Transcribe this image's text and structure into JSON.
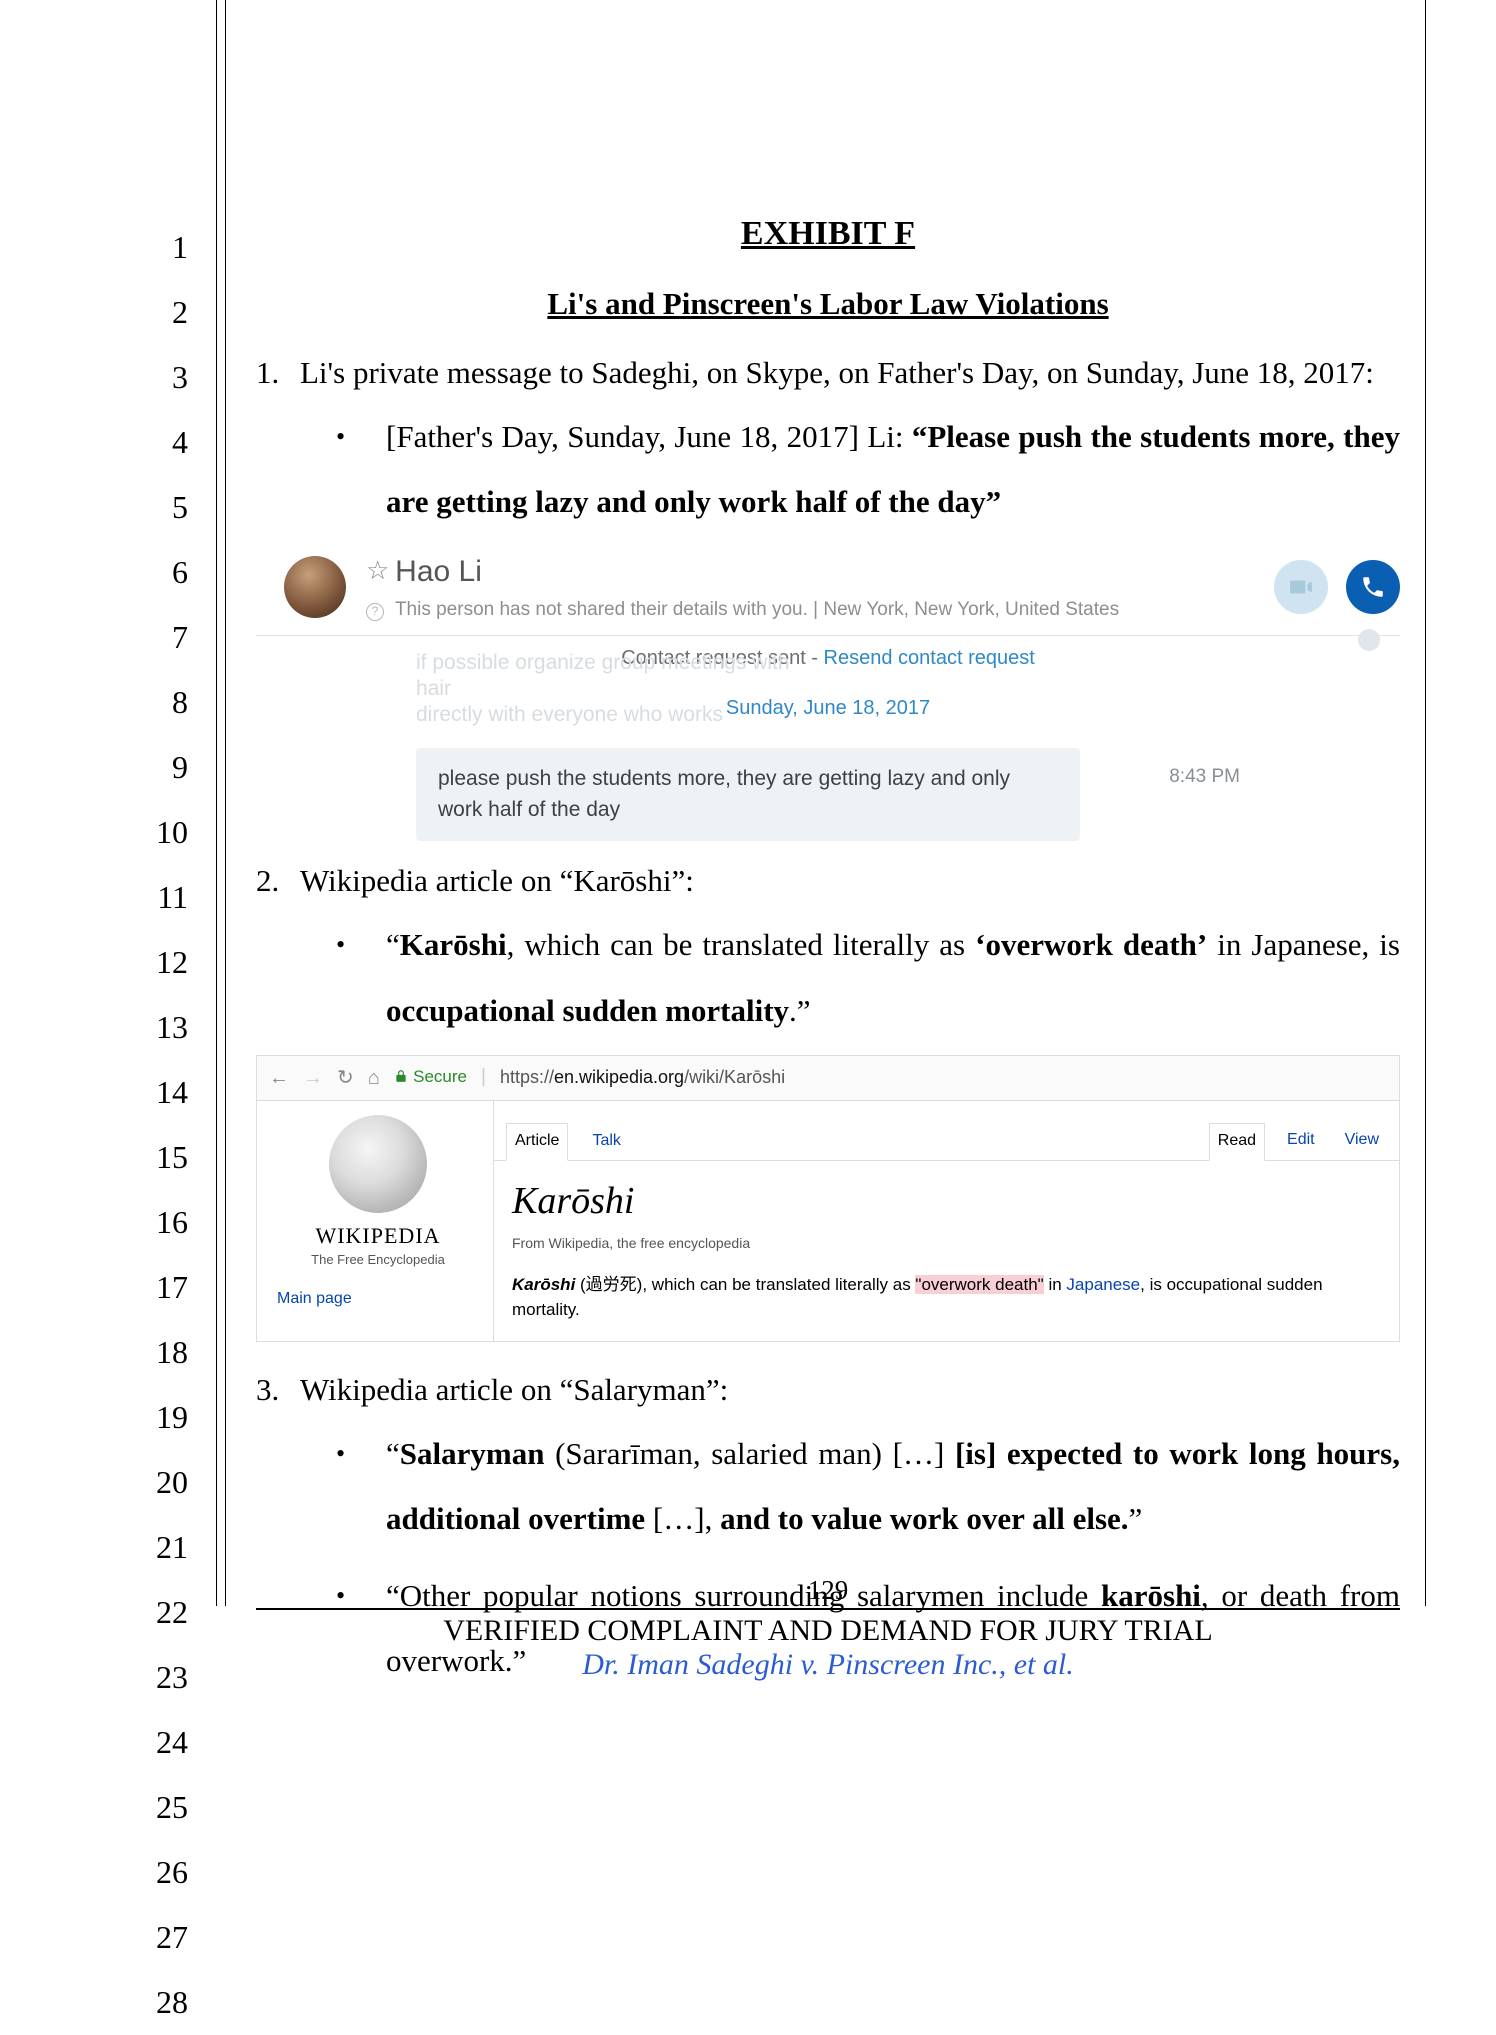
{
  "line_numbers": [
    "1",
    "2",
    "3",
    "4",
    "5",
    "6",
    "7",
    "8",
    "9",
    "10",
    "11",
    "12",
    "13",
    "14",
    "15",
    "16",
    "17",
    "18",
    "19",
    "20",
    "21",
    "22",
    "23",
    "24",
    "25",
    "26",
    "27",
    "28"
  ],
  "title1": "EXHIBIT F",
  "title2": "Li's and Pinscreen's Labor Law Violations",
  "item1": {
    "num": "1.",
    "text": "Li's private message to Sadeghi, on Skype, on Father's Day, on Sunday, June 18, 2017:",
    "bullet_prefix": "[Father's Day, Sunday, June 18, 2017] Li: ",
    "bullet_quote": "“Please push the students more, they are getting lazy and only work half of the day”"
  },
  "skype": {
    "name": "Hao Li",
    "star": "☆",
    "sub_prefix": "This person has not shared their details with you.  |  ",
    "sub_location": "New York, New York, United States",
    "help_glyph": "?",
    "contact_line_pre": "Contact request sent - ",
    "contact_link": "Resend contact request",
    "faded1": "if possible organize group meetings with hair",
    "faded2": "directly with everyone who works",
    "date": "Sunday, June 18, 2017",
    "msg": "please push the students more, they are getting lazy and only work half of the day",
    "time": "8:43 PM"
  },
  "item2": {
    "num": "2.",
    "text": "Wikipedia article on “Karōshi”:",
    "bullet_pre": "“",
    "bullet_k": "Karōshi",
    "bullet_mid": ", which can be translated literally as ",
    "bullet_q": "‘overwork death’",
    "bullet_post1": " in Japanese, is ",
    "bullet_post2": "occupational sudden mortality",
    "bullet_end": ".”"
  },
  "browser": {
    "back": "←",
    "fwd": "→",
    "reload": "↻",
    "home": "⌂",
    "lock": "▲",
    "secure": "Secure",
    "url_pre": "https://",
    "url_dom": "en.wikipedia.org",
    "url_path": "/wiki/Karōshi"
  },
  "wiki": {
    "name": "WIKIPEDIA",
    "tag": "The Free Encyclopedia",
    "mainpage": "Main page",
    "tab_article": "Article",
    "tab_talk": "Talk",
    "tab_read": "Read",
    "tab_edit": "Edit",
    "tab_view": "View",
    "h1": "Karōshi",
    "from": "From Wikipedia, the free encyclopedia",
    "p_k": "Karōshi",
    "p_paren": " (過労死), which can be translated literally as ",
    "p_hl": "\"overwork death\"",
    "p_in": " in ",
    "p_jp": "Japanese",
    "p_tail": ", is occupational sudden mortality."
  },
  "item3": {
    "num": "3.",
    "text": "Wikipedia article on “Salaryman”:",
    "b1_pre": "“",
    "b1_s": "Salaryman",
    "b1_mid": " (Sararīman, salaried man) […] ",
    "b1_is": "[is] expected to work long hours, additional overtime",
    "b1_mid2": " […], ",
    "b1_and": "and to value work over all else.",
    "b1_end": "”",
    "b2_pre": "“Other popular notions surrounding salarymen include ",
    "b2_k": "karōshi",
    "b2_post": ", or death from overwork.”"
  },
  "footer": {
    "page": "129",
    "title": "VERIFIED COMPLAINT AND DEMAND FOR JURY TRIAL",
    "case": "Dr. Iman Sadeghi v. Pinscreen Inc., et al."
  }
}
